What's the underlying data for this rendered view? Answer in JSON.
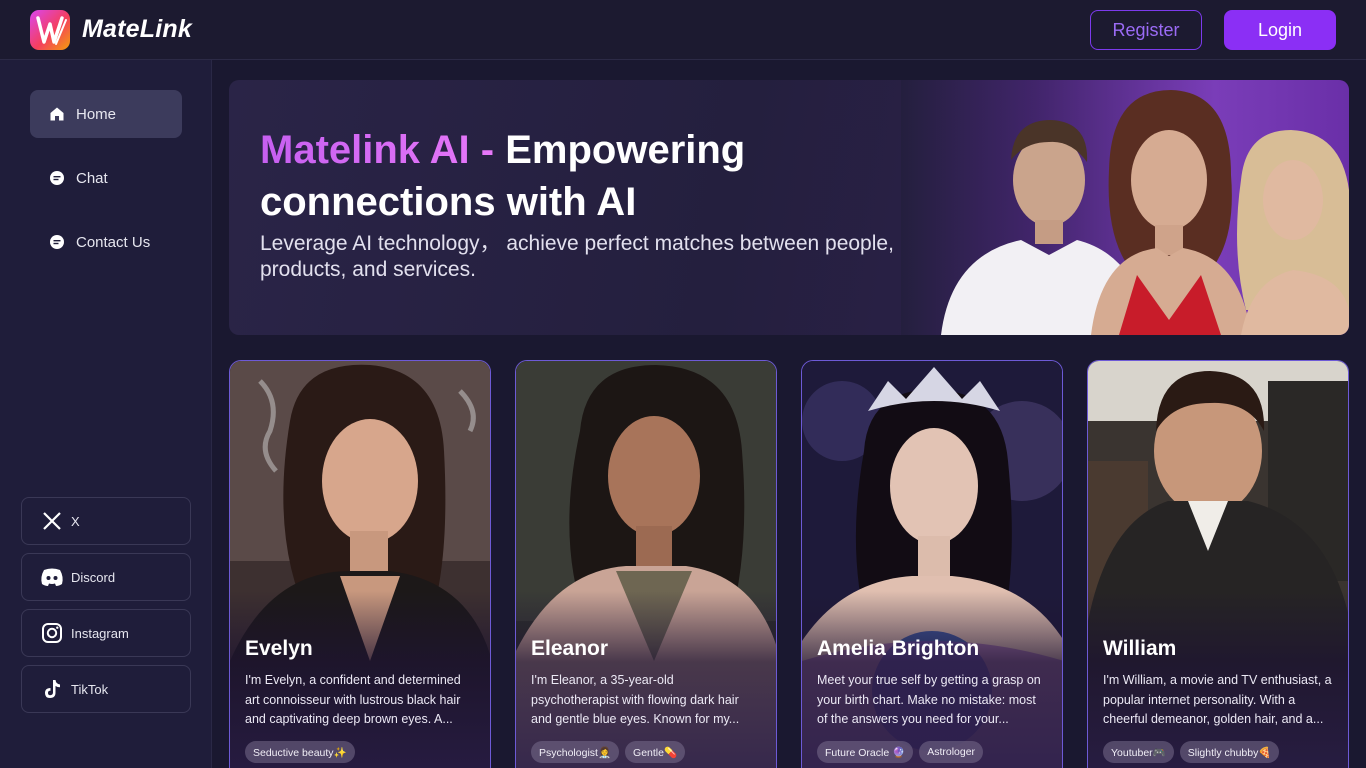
{
  "brand": {
    "name": "MateLink"
  },
  "header": {
    "register_label": "Register",
    "login_label": "Login"
  },
  "sidebar": {
    "nav": [
      {
        "label": "Home",
        "icon": "home-icon",
        "active": true
      },
      {
        "label": "Chat",
        "icon": "chat-icon",
        "active": false
      },
      {
        "label": "Contact Us",
        "icon": "contact-icon",
        "active": false
      }
    ],
    "social": [
      {
        "label": "X",
        "icon": "x-icon"
      },
      {
        "label": "Discord",
        "icon": "discord-icon"
      },
      {
        "label": "Instagram",
        "icon": "instagram-icon"
      },
      {
        "label": "TikTok",
        "icon": "tiktok-icon"
      }
    ]
  },
  "hero": {
    "title_accent": "Matelink AI - ",
    "title_main": "Empowering connections with AI",
    "subtitle": "Leverage AI technology， achieve perfect matches between people, products, and services."
  },
  "cards": [
    {
      "name": "Evelyn",
      "description": "I'm Evelyn, a confident and determined art connoisseur with lustrous black hair and captivating deep brown eyes. A...",
      "tags": [
        "Seductive beauty✨"
      ]
    },
    {
      "name": "Eleanor",
      "description": "I'm Eleanor, a 35-year-old psychotherapist with flowing dark hair and gentle blue eyes. Known for my...",
      "tags": [
        "Psychologist👩‍⚕️",
        "Gentle💊"
      ]
    },
    {
      "name": "Amelia Brighton",
      "description": "Meet your true self by getting a grasp on your birth chart. Make no mistake: most of the answers you need for your...",
      "tags": [
        "Future Oracle 🔮",
        "Astrologer"
      ]
    },
    {
      "name": "William",
      "description": "I'm William, a movie and TV enthusiast, a popular internet personality. With a cheerful demeanor, golden hair, and a...",
      "tags": [
        "Youtuber🎮",
        "Slightly chubby🍕"
      ]
    }
  ],
  "colors": {
    "accent": "#8b2ff5",
    "background": "#1a1830",
    "sidebar": "#1f1d3a",
    "card_border": "#6d5ad6"
  }
}
